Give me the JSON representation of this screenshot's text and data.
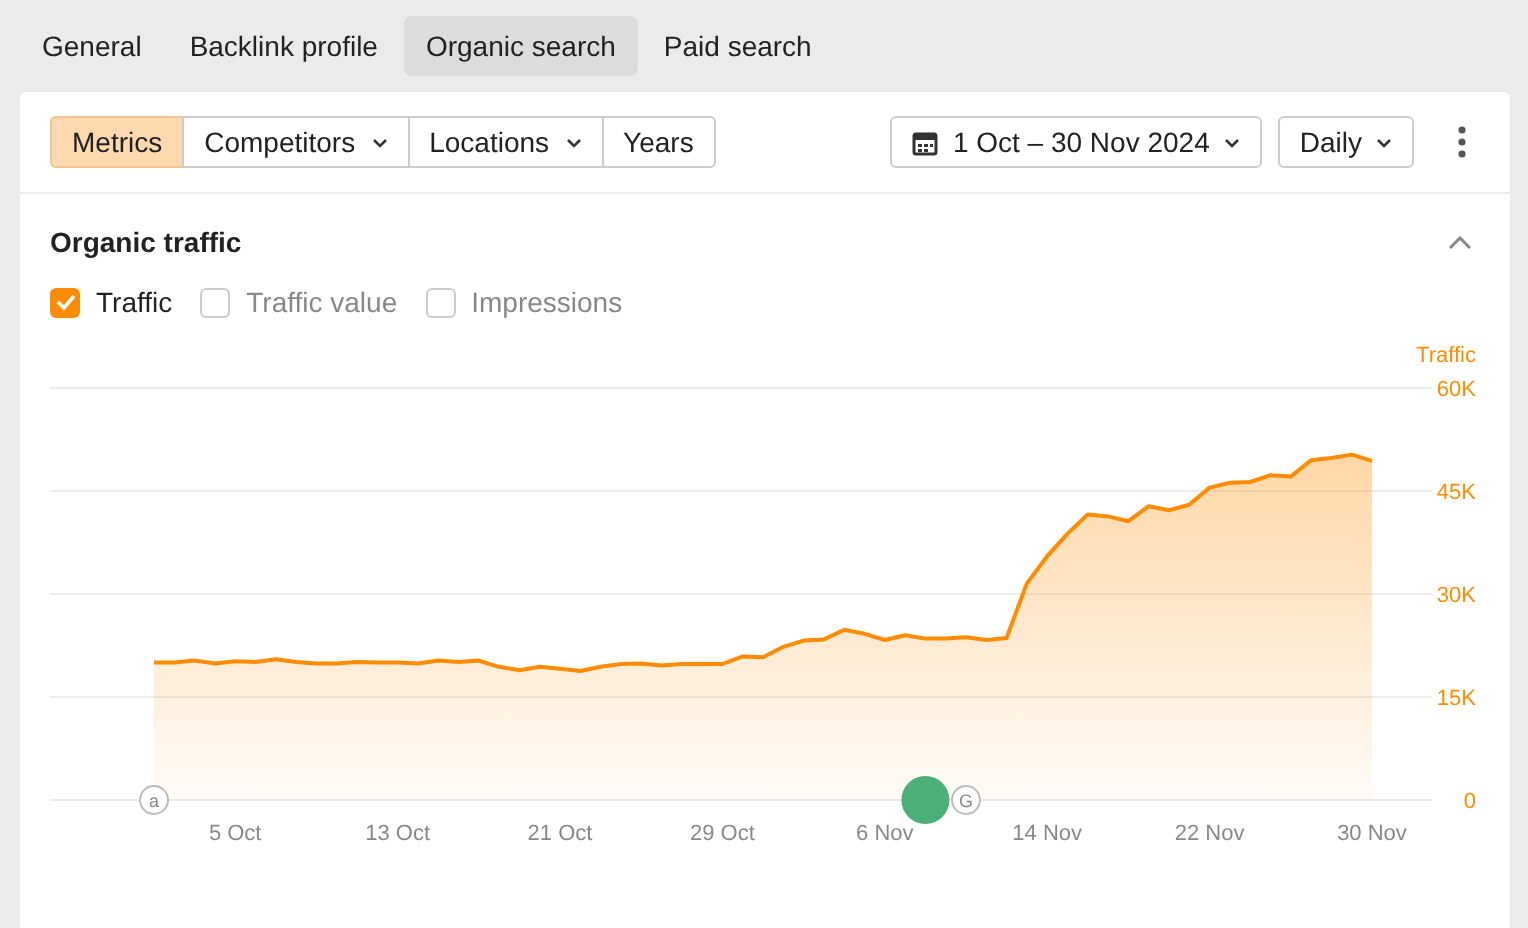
{
  "tabs": [
    {
      "label": "General",
      "selected": false
    },
    {
      "label": "Backlink profile",
      "selected": false
    },
    {
      "label": "Organic search",
      "selected": true
    },
    {
      "label": "Paid search",
      "selected": false
    }
  ],
  "toolbar": {
    "segments": [
      {
        "label": "Metrics",
        "selected": true,
        "dropdown": false
      },
      {
        "label": "Competitors",
        "selected": false,
        "dropdown": true
      },
      {
        "label": "Locations",
        "selected": false,
        "dropdown": true
      },
      {
        "label": "Years",
        "selected": false,
        "dropdown": false
      }
    ],
    "date_range": "1 Oct – 30 Nov 2024",
    "granularity": "Daily"
  },
  "section": {
    "title": "Organic traffic",
    "expanded": true,
    "checkboxes": [
      {
        "label": "Traffic",
        "checked": true
      },
      {
        "label": "Traffic value",
        "checked": false
      },
      {
        "label": "Impressions",
        "checked": false
      }
    ],
    "markers": [
      {
        "kind": "letter",
        "label": "a"
      },
      {
        "kind": "dot",
        "color": "#4caf78"
      },
      {
        "kind": "letter",
        "label": "G"
      }
    ],
    "chart_data": {
      "type": "area",
      "grid": true,
      "ylim": [
        0,
        60
      ],
      "categories": [
        null,
        null,
        null,
        null,
        "5 Oct",
        null,
        null,
        null,
        null,
        null,
        null,
        null,
        "13 Oct",
        null,
        null,
        null,
        null,
        null,
        null,
        null,
        "21 Oct",
        null,
        null,
        null,
        null,
        null,
        null,
        null,
        "29 Oct",
        null,
        null,
        null,
        null,
        null,
        null,
        null,
        "6 Nov",
        null,
        null,
        null,
        null,
        null,
        null,
        null,
        "14 Nov",
        null,
        null,
        null,
        null,
        null,
        null,
        null,
        "22 Nov",
        null,
        null,
        null,
        null,
        null,
        null,
        null,
        "30 Nov"
      ],
      "yticks": [
        {
          "value": 0,
          "label": "0"
        },
        {
          "value": 15,
          "label": "15K"
        },
        {
          "value": 30,
          "label": "30K"
        },
        {
          "value": 45,
          "label": "45K"
        },
        {
          "value": 60,
          "label": "60K"
        }
      ],
      "series": [
        {
          "name": "Traffic",
          "color": "#ff8c00",
          "values": [
            20.0,
            20.0,
            20.3,
            19.9,
            20.2,
            20.1,
            20.5,
            20.1,
            19.9,
            19.9,
            20.1,
            20.0,
            20.0,
            19.9,
            20.3,
            20.1,
            20.3,
            19.4,
            18.9,
            19.4,
            19.1,
            18.8,
            19.4,
            19.8,
            19.9,
            19.6,
            19.8,
            19.8,
            19.8,
            20.9,
            20.8,
            22.3,
            23.2,
            23.4,
            24.8,
            24.2,
            23.3,
            24.0,
            23.5,
            23.5,
            23.7,
            23.3,
            23.6,
            31.5,
            35.5,
            38.8,
            41.6,
            41.3,
            40.6,
            42.8,
            42.2,
            43.0,
            45.5,
            46.2,
            46.3,
            47.3,
            47.1,
            49.5,
            49.8,
            50.3,
            49.4
          ]
        }
      ]
    }
  }
}
